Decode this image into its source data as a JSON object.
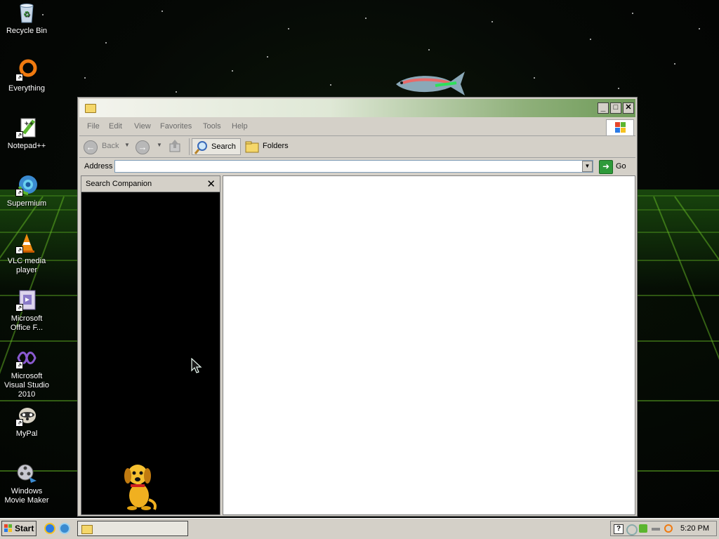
{
  "desktop": {
    "icons": [
      {
        "label": "Recycle Bin",
        "icon": "recycle-bin-icon"
      },
      {
        "label": "Everything",
        "icon": "everything-search-icon"
      },
      {
        "label": "Notepad++",
        "icon": "notepad-plus-plus-icon"
      },
      {
        "label": "Supermium",
        "icon": "supermium-browser-icon"
      },
      {
        "label": "VLC media player",
        "icon": "vlc-cone-icon"
      },
      {
        "label": "Microsoft Office F...",
        "icon": "office-file-icon"
      },
      {
        "label": "Microsoft Visual Studio 2010",
        "icon": "visual-studio-icon"
      },
      {
        "label": "MyPal",
        "icon": "mypal-raccoon-icon"
      },
      {
        "label": "Windows Movie Maker",
        "icon": "movie-maker-icon"
      }
    ]
  },
  "window": {
    "menu": [
      "File",
      "Edit",
      "View",
      "Favorites",
      "Tools",
      "Help"
    ],
    "toolbar": {
      "back_label": "Back",
      "search_label": "Search",
      "folders_label": "Folders"
    },
    "address": {
      "label": "Address",
      "value": "",
      "go_label": "Go"
    },
    "search_pane": {
      "title": "Search Companion",
      "close_glyph": "✕"
    },
    "title_buttons": {
      "minimize": "_",
      "maximize": "□",
      "close": "✕"
    }
  },
  "taskbar": {
    "start_label": "Start",
    "clock": "5:20 PM",
    "help_glyph": "?"
  },
  "colors": {
    "grid_green": "#6ec828",
    "title_gradient_end": "#6e9a58",
    "xp_red": "#e5462a",
    "xp_green": "#5bb52f",
    "xp_blue": "#2a7ae5",
    "xp_yellow": "#f5c221"
  }
}
